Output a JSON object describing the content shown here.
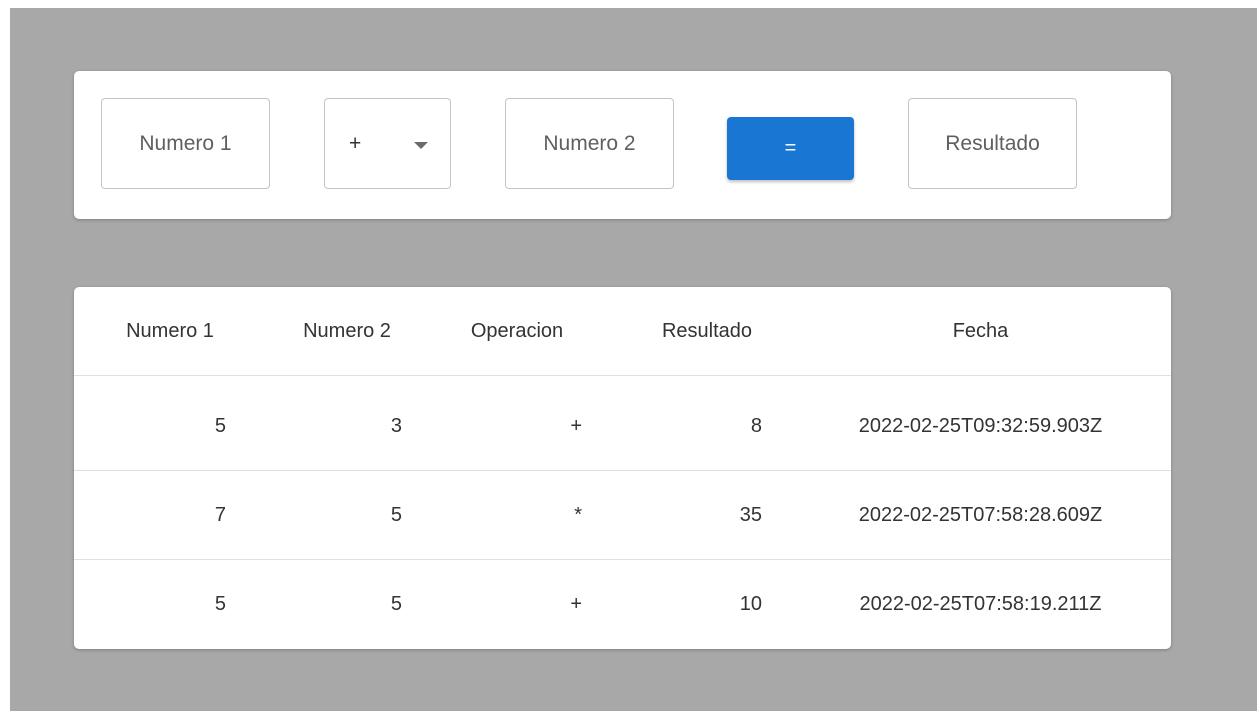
{
  "calculator": {
    "numero1_placeholder": "Numero 1",
    "operator_value": "+",
    "numero2_placeholder": "Numero 2",
    "equals_label": "=",
    "resultado_placeholder": "Resultado",
    "accent_color": "#1976d2"
  },
  "history": {
    "columns": [
      "Numero 1",
      "Numero 2",
      "Operacion",
      "Resultado",
      "Fecha"
    ],
    "rows": [
      {
        "numero1": "5",
        "numero2": "3",
        "operacion": "+",
        "resultado": "8",
        "fecha": "2022-02-25T09:32:59.903Z"
      },
      {
        "numero1": "7",
        "numero2": "5",
        "operacion": "*",
        "resultado": "35",
        "fecha": "2022-02-25T07:58:28.609Z"
      },
      {
        "numero1": "5",
        "numero2": "5",
        "operacion": "+",
        "resultado": "10",
        "fecha": "2022-02-25T07:58:19.211Z"
      }
    ]
  }
}
